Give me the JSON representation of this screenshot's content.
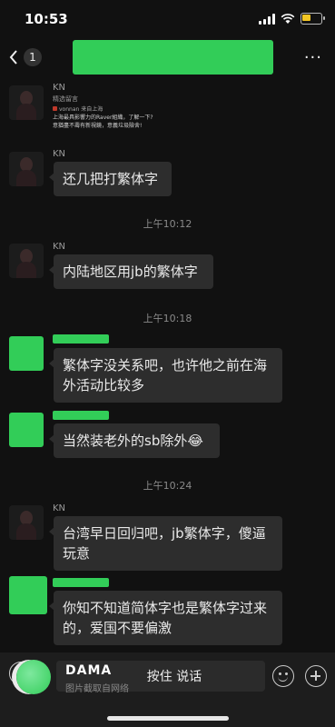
{
  "status": {
    "time": "10:53"
  },
  "nav": {
    "unread_count": "1",
    "more": "···"
  },
  "messages": [
    {
      "sender": "KN",
      "quote_source": "vonnan 来自上海",
      "quote_line1": "上海最具影響力的Raver組織，了解一下?",
      "quote_line2": "意猶盡不壽有新視鏡，意義垃圾險舍!"
    },
    {
      "sender": "KN",
      "text": "还几把打繁体字"
    },
    {
      "sender": "KN",
      "text": "内陆地区用jb的繁体字"
    },
    {
      "sender": "",
      "text": "繁体字没关系吧，也许他之前在海外活动比较多"
    },
    {
      "sender": "",
      "text": "当然装老外的sb除外😂"
    },
    {
      "sender": "KN",
      "text": "台湾早日回归吧，jb繁体字，傻逼玩意"
    },
    {
      "sender": "",
      "text": "你知不知道简体字也是繁体字过来的，爱国不要偏激"
    }
  ],
  "timestamps": [
    "上午10:12",
    "上午10:18",
    "上午10:24"
  ],
  "input": {
    "hold_to_talk": "按住 说话",
    "watermark": "DAMA",
    "watermark_sub": "图片截取自网络"
  },
  "colors": {
    "redaction": "#32cd58",
    "bubble": "#2d2d2d",
    "background": "#111111"
  }
}
